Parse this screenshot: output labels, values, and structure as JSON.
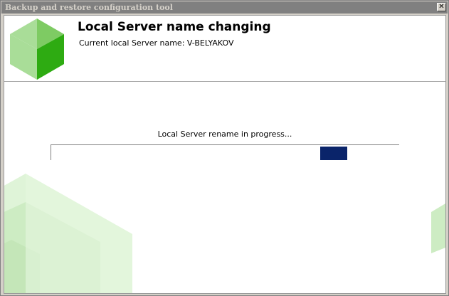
{
  "window": {
    "title": "Backup and restore configuration tool",
    "close_glyph": "✕"
  },
  "header": {
    "heading": "Local Server name changing",
    "subheading": "Current local Server name: V-BELYAKOV",
    "logo_icon": "product-logo-icon"
  },
  "progress": {
    "status_text": "Local Server rename in progress...",
    "marquee_chunk_start_fraction": 0.773,
    "marquee_chunk_width_fraction": 0.078,
    "chunk_color": "#0a246a"
  },
  "colors": {
    "brand_green_dark": "#2eab12",
    "brand_green_light": "#9fd88f",
    "watermark_green": "#d8f2d0"
  }
}
